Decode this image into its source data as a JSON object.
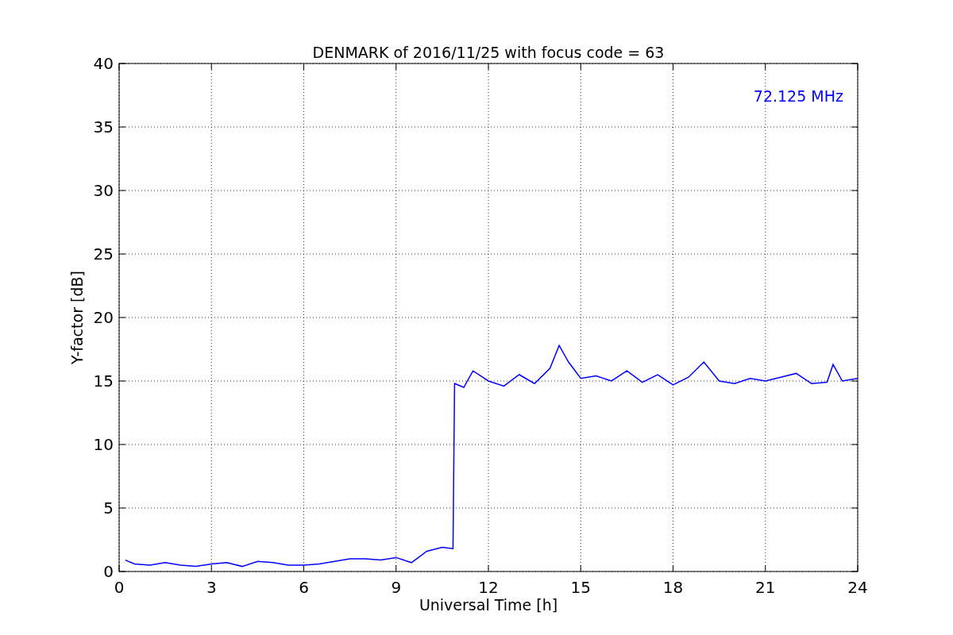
{
  "chart_data": {
    "type": "line",
    "title": "DENMARK of 2016/11/25 with focus code = 63",
    "xlabel": "Universal Time [h]",
    "ylabel": "Y-factor [dB]",
    "x": [
      0.2,
      0.5,
      1,
      1.5,
      2,
      2.5,
      3,
      3.5,
      4,
      4.5,
      5,
      5.5,
      6,
      6.5,
      7,
      7.5,
      8,
      8.5,
      9,
      9.5,
      10,
      10.5,
      10.85,
      10.9,
      11.2,
      11.5,
      12,
      12.5,
      13,
      13.5,
      14,
      14.3,
      14.6,
      15,
      15.5,
      16,
      16.5,
      17,
      17.5,
      18,
      18.5,
      19,
      19.5,
      20,
      20.5,
      21,
      21.5,
      22,
      22.5,
      23,
      23.2,
      23.5,
      24
    ],
    "series": [
      {
        "name": "72.125 MHz",
        "color": "#0000ff",
        "values": [
          0.9,
          0.6,
          0.5,
          0.7,
          0.5,
          0.4,
          0.6,
          0.7,
          0.4,
          0.8,
          0.7,
          0.5,
          0.5,
          0.6,
          0.8,
          1.0,
          1.0,
          0.9,
          1.1,
          0.7,
          1.6,
          1.9,
          1.8,
          14.8,
          14.5,
          15.8,
          15.0,
          14.6,
          15.5,
          14.8,
          16.0,
          17.8,
          16.5,
          15.2,
          15.4,
          15.0,
          15.8,
          14.9,
          15.5,
          14.7,
          15.3,
          16.5,
          15.0,
          14.8,
          15.2,
          15.0,
          15.3,
          15.6,
          14.8,
          14.9,
          16.3,
          15.0,
          15.2
        ]
      }
    ],
    "xlim": [
      0,
      24
    ],
    "ylim": [
      0,
      40
    ],
    "grid": true,
    "xticks": [
      0,
      3,
      6,
      9,
      12,
      15,
      18,
      21,
      24
    ],
    "yticks": [
      0,
      5,
      10,
      15,
      20,
      25,
      30,
      35,
      40
    ]
  }
}
